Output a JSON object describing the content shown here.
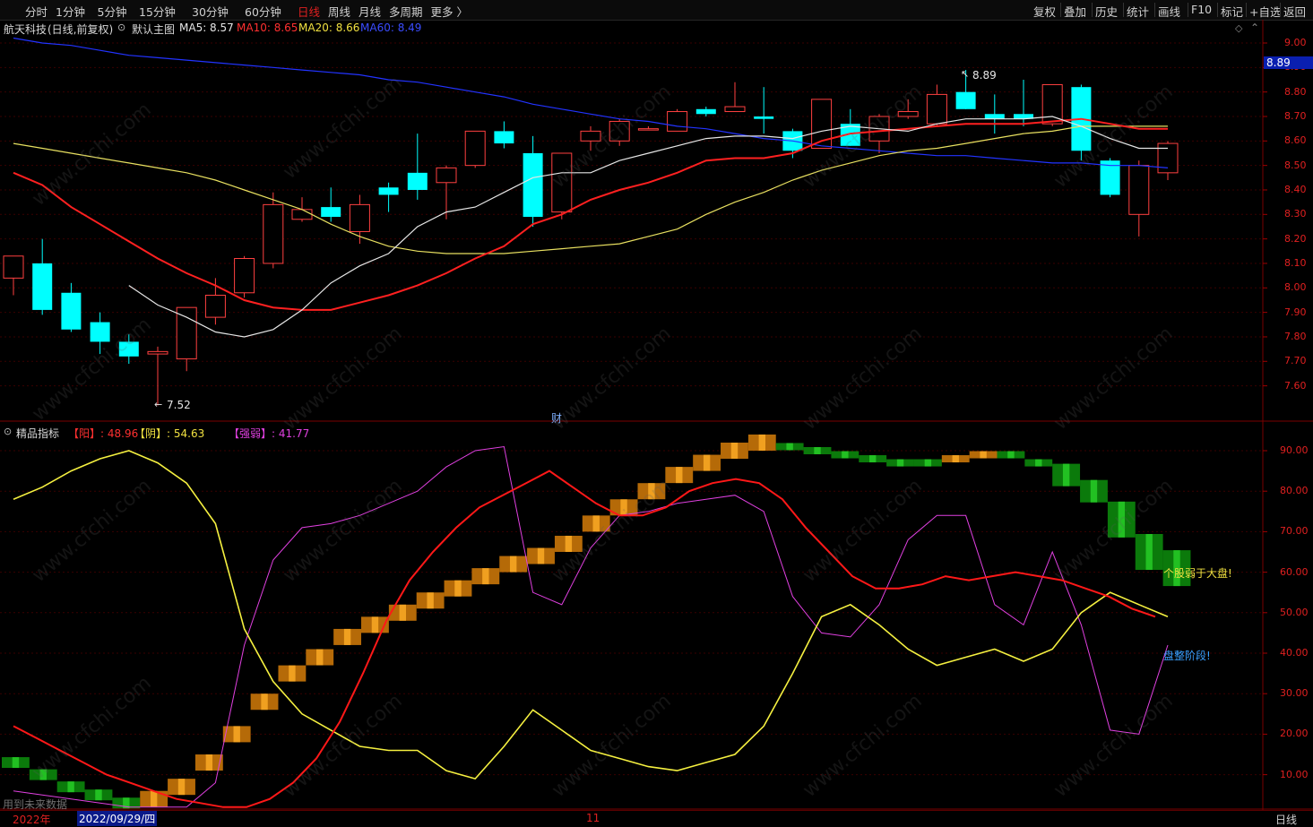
{
  "toolbar": {
    "periods": [
      "分时",
      "1分钟",
      "5分钟",
      "15分钟",
      "30分钟",
      "60分钟",
      "日线",
      "周线",
      "月线",
      "多周期",
      "更多 〉"
    ],
    "active_period": "日线",
    "right_buttons": [
      "复权",
      "叠加",
      "历史",
      "统计",
      "画线",
      "F10",
      "标记",
      "+自选",
      "返回"
    ]
  },
  "main_chart": {
    "stock_name": "航天科技",
    "mode": "(日线,前复权)",
    "template_name": "默认主图",
    "ma_labels": [
      {
        "text": "MA5: 8.57",
        "color": "#e6e6e6"
      },
      {
        "text": "MA10: 8.65",
        "color": "#ff3030"
      },
      {
        "text": "MA20: 8.66",
        "color": "#f0e040"
      },
      {
        "text": "MA60: 8.49",
        "color": "#3a4cff"
      }
    ],
    "price_axis": [
      "9.00",
      "8.90",
      "8.80",
      "8.70",
      "8.60",
      "8.50",
      "8.40",
      "8.30",
      "8.20",
      "8.10",
      "8.00",
      "7.90",
      "7.80",
      "7.70",
      "7.60"
    ],
    "current_price": "8.89",
    "high_label": "8.89",
    "low_label": "7.52",
    "cai_marker": "财"
  },
  "indicator": {
    "name": "精品指标",
    "labels": [
      {
        "text": "【阳】: 48.96",
        "color": "#ff3030"
      },
      {
        "text": "【阴】: 54.63",
        "color": "#f0e040"
      },
      {
        "text": "【强弱】: 41.77",
        "color": "#e040e0"
      }
    ],
    "axis": [
      "90.00",
      "80.00",
      "70.00",
      "60.00",
      "50.00",
      "40.00",
      "30.00",
      "20.00",
      "10.00"
    ],
    "note_weak": "个股弱于大盘!",
    "note_consolidation": "盘整阶段!",
    "future_data_note": "用到未来数据"
  },
  "bottom_bar": {
    "year": "2022年",
    "cursor_date": "2022/09/29/四",
    "month_mark": "11",
    "period_label": "日线"
  },
  "watermark": "www.cfchi.com",
  "candles": [
    {
      "o": 8.04,
      "h": 8.13,
      "l": 7.97,
      "c": 8.13
    },
    {
      "o": 8.1,
      "h": 8.2,
      "l": 7.89,
      "c": 7.91
    },
    {
      "o": 7.98,
      "h": 8.02,
      "l": 7.82,
      "c": 7.83
    },
    {
      "o": 7.86,
      "h": 7.9,
      "l": 7.73,
      "c": 7.78
    },
    {
      "o": 7.78,
      "h": 7.81,
      "l": 7.69,
      "c": 7.72
    },
    {
      "o": 7.73,
      "h": 7.76,
      "l": 7.52,
      "c": 7.74
    },
    {
      "o": 7.71,
      "h": 7.92,
      "l": 7.66,
      "c": 7.92
    },
    {
      "o": 7.88,
      "h": 8.04,
      "l": 7.85,
      "c": 7.97
    },
    {
      "o": 7.98,
      "h": 8.13,
      "l": 7.96,
      "c": 8.12
    },
    {
      "o": 8.1,
      "h": 8.39,
      "l": 8.08,
      "c": 8.34
    },
    {
      "o": 8.28,
      "h": 8.37,
      "l": 8.27,
      "c": 8.32
    },
    {
      "o": 8.33,
      "h": 8.41,
      "l": 8.27,
      "c": 8.29
    },
    {
      "o": 8.23,
      "h": 8.38,
      "l": 8.18,
      "c": 8.34
    },
    {
      "o": 8.41,
      "h": 8.43,
      "l": 8.31,
      "c": 8.38
    },
    {
      "o": 8.47,
      "h": 8.63,
      "l": 8.36,
      "c": 8.4
    },
    {
      "o": 8.43,
      "h": 8.5,
      "l": 8.28,
      "c": 8.49
    },
    {
      "o": 8.5,
      "h": 8.64,
      "l": 8.49,
      "c": 8.64
    },
    {
      "o": 8.64,
      "h": 8.68,
      "l": 8.57,
      "c": 8.59
    },
    {
      "o": 8.55,
      "h": 8.62,
      "l": 8.25,
      "c": 8.29
    },
    {
      "o": 8.31,
      "h": 8.55,
      "l": 8.28,
      "c": 8.55
    },
    {
      "o": 8.6,
      "h": 8.66,
      "l": 8.56,
      "c": 8.64
    },
    {
      "o": 8.6,
      "h": 8.69,
      "l": 8.58,
      "c": 8.68
    },
    {
      "o": 8.65,
      "h": 8.66,
      "l": 8.65,
      "c": 8.65
    },
    {
      "o": 8.64,
      "h": 8.73,
      "l": 8.64,
      "c": 8.72
    },
    {
      "o": 8.73,
      "h": 8.74,
      "l": 8.7,
      "c": 8.71
    },
    {
      "o": 8.72,
      "h": 8.84,
      "l": 8.72,
      "c": 8.74
    },
    {
      "o": 8.7,
      "h": 8.82,
      "l": 8.63,
      "c": 8.69
    },
    {
      "o": 8.64,
      "h": 8.65,
      "l": 8.53,
      "c": 8.56
    },
    {
      "o": 8.57,
      "h": 8.77,
      "l": 8.57,
      "c": 8.77
    },
    {
      "o": 8.67,
      "h": 8.73,
      "l": 8.58,
      "c": 8.58
    },
    {
      "o": 8.6,
      "h": 8.71,
      "l": 8.55,
      "c": 8.7
    },
    {
      "o": 8.7,
      "h": 8.77,
      "l": 8.69,
      "c": 8.72
    },
    {
      "o": 8.67,
      "h": 8.83,
      "l": 8.66,
      "c": 8.79
    },
    {
      "o": 8.8,
      "h": 8.89,
      "l": 8.73,
      "c": 8.73
    },
    {
      "o": 8.71,
      "h": 8.79,
      "l": 8.63,
      "c": 8.69
    },
    {
      "o": 8.71,
      "h": 8.85,
      "l": 8.66,
      "c": 8.69
    },
    {
      "o": 8.67,
      "h": 8.83,
      "l": 8.66,
      "c": 8.83
    },
    {
      "o": 8.82,
      "h": 8.83,
      "l": 8.52,
      "c": 8.56
    },
    {
      "o": 8.52,
      "h": 8.53,
      "l": 8.37,
      "c": 8.38
    },
    {
      "o": 8.3,
      "h": 8.52,
      "l": 8.21,
      "c": 8.5
    },
    {
      "o": 8.47,
      "h": 8.6,
      "l": 8.44,
      "c": 8.59
    }
  ],
  "ma5": [
    null,
    null,
    null,
    null,
    8.01,
    7.93,
    7.88,
    7.82,
    7.8,
    7.83,
    7.91,
    8.02,
    8.09,
    8.14,
    8.25,
    8.31,
    8.33,
    8.39,
    8.45,
    8.47,
    8.47,
    8.52,
    8.55,
    8.58,
    8.61,
    8.62,
    8.62,
    8.61,
    8.64,
    8.66,
    8.65,
    8.64,
    8.67,
    8.69,
    8.69,
    8.69,
    8.7,
    8.66,
    8.61,
    8.57,
    8.57
  ],
  "ma10": [
    8.47,
    8.42,
    8.33,
    8.26,
    8.19,
    8.12,
    8.06,
    8.01,
    7.95,
    7.92,
    7.91,
    7.91,
    7.94,
    7.97,
    8.01,
    8.06,
    8.12,
    8.17,
    8.26,
    8.3,
    8.36,
    8.4,
    8.43,
    8.47,
    8.52,
    8.53,
    8.53,
    8.55,
    8.6,
    8.63,
    8.64,
    8.65,
    8.66,
    8.67,
    8.67,
    8.67,
    8.68,
    8.69,
    8.67,
    8.65,
    8.65
  ],
  "ma20": [
    8.59,
    8.57,
    8.55,
    8.53,
    8.51,
    8.49,
    8.47,
    8.44,
    8.4,
    8.36,
    8.32,
    8.26,
    8.21,
    8.17,
    8.15,
    8.14,
    8.14,
    8.14,
    8.15,
    8.16,
    8.17,
    8.18,
    8.21,
    8.24,
    8.3,
    8.35,
    8.39,
    8.44,
    8.48,
    8.51,
    8.54,
    8.56,
    8.57,
    8.59,
    8.61,
    8.63,
    8.64,
    8.66,
    8.66,
    8.66,
    8.66
  ],
  "ma60": [
    9.02,
    9.0,
    8.99,
    8.97,
    8.95,
    8.94,
    8.93,
    8.92,
    8.91,
    8.9,
    8.89,
    8.88,
    8.87,
    8.85,
    8.84,
    8.82,
    8.8,
    8.78,
    8.75,
    8.73,
    8.71,
    8.69,
    8.68,
    8.66,
    8.65,
    8.63,
    8.61,
    8.6,
    8.58,
    8.57,
    8.56,
    8.55,
    8.54,
    8.54,
    8.53,
    8.52,
    8.51,
    8.51,
    8.5,
    8.5,
    8.49
  ],
  "ind_yang": [
    22,
    19,
    16,
    13,
    10,
    8,
    6,
    4,
    3,
    2,
    2,
    4,
    8,
    14,
    23,
    35,
    48,
    58,
    65,
    71,
    76,
    79,
    82,
    85,
    81,
    77,
    74,
    74,
    76,
    80,
    82,
    83,
    82,
    78,
    71,
    65,
    59,
    56,
    56,
    57,
    59,
    58,
    59,
    60,
    59,
    58,
    56,
    54,
    51,
    49
  ],
  "ind_yin": [
    78,
    81,
    85,
    88,
    90,
    87,
    82,
    72,
    46,
    33,
    25,
    21,
    17,
    16,
    16,
    11,
    9,
    17,
    26,
    21,
    16,
    14,
    12,
    11,
    13,
    15,
    22,
    35,
    49,
    52,
    47,
    41,
    37,
    39,
    41,
    38,
    41,
    50,
    55,
    52,
    49
  ],
  "ind_qr": [
    6,
    5,
    4,
    3,
    2,
    2,
    2,
    8,
    42,
    63,
    71,
    72,
    74,
    77,
    80,
    86,
    90,
    91,
    55,
    52,
    66,
    74,
    75,
    77,
    78,
    79,
    75,
    54,
    45,
    44,
    52,
    68,
    74,
    74,
    52,
    47,
    65,
    47,
    21,
    20,
    42
  ],
  "ind_bars": [
    {
      "v": 13,
      "c": "g"
    },
    {
      "v": 10,
      "c": "g"
    },
    {
      "v": 7,
      "c": "g"
    },
    {
      "v": 5,
      "c": "g"
    },
    {
      "v": 3,
      "c": "g"
    },
    {
      "v": 4,
      "c": "o"
    },
    {
      "v": 7,
      "c": "o"
    },
    {
      "v": 13,
      "c": "o"
    },
    {
      "v": 20,
      "c": "o"
    },
    {
      "v": 28,
      "c": "o"
    },
    {
      "v": 35,
      "c": "o"
    },
    {
      "v": 39,
      "c": "o"
    },
    {
      "v": 44,
      "c": "o"
    },
    {
      "v": 47,
      "c": "o"
    },
    {
      "v": 50,
      "c": "o"
    },
    {
      "v": 53,
      "c": "o"
    },
    {
      "v": 56,
      "c": "o"
    },
    {
      "v": 59,
      "c": "o"
    },
    {
      "v": 62,
      "c": "o"
    },
    {
      "v": 64,
      "c": "o"
    },
    {
      "v": 67,
      "c": "o"
    },
    {
      "v": 72,
      "c": "o"
    },
    {
      "v": 76,
      "c": "o"
    },
    {
      "v": 80,
      "c": "o"
    },
    {
      "v": 84,
      "c": "o"
    },
    {
      "v": 87,
      "c": "o"
    },
    {
      "v": 90,
      "c": "o"
    },
    {
      "v": 92,
      "c": "o"
    },
    {
      "v": 91,
      "c": "g"
    },
    {
      "v": 90,
      "c": "g"
    },
    {
      "v": 89,
      "c": "g"
    },
    {
      "v": 88,
      "c": "g"
    },
    {
      "v": 87,
      "c": "g"
    },
    {
      "v": 87,
      "c": "g"
    },
    {
      "v": 88,
      "c": "o"
    },
    {
      "v": 89,
      "c": "o"
    },
    {
      "v": 89,
      "c": "g"
    },
    {
      "v": 87,
      "c": "g"
    },
    {
      "v": 84,
      "c": "g"
    },
    {
      "v": 80,
      "c": "g"
    },
    {
      "v": 73,
      "c": "g"
    },
    {
      "v": 65,
      "c": "g"
    },
    {
      "v": 61,
      "c": "g"
    }
  ]
}
